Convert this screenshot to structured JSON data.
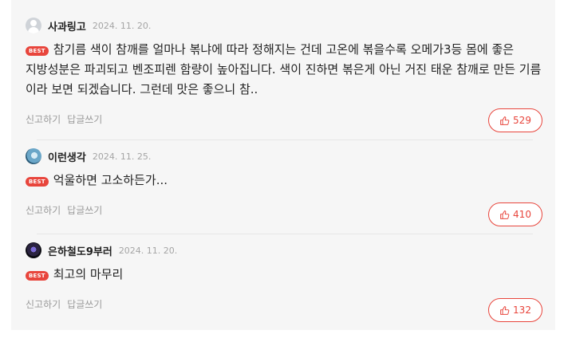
{
  "colors": {
    "accent": "#e8453c",
    "muted": "#9a9a9a",
    "panel_bg": "#f6f6f6"
  },
  "comments": [
    {
      "nickname": "사과링고",
      "date": "2024. 11. 20.",
      "avatar_icon": "default-user-icon",
      "badge": "BEST",
      "text": "참기름 색이 참깨를 얼마나 볶냐에 따라 정해지는 건데 고온에 볶을수록 오메가3등 몸에 좋은 지방성분은 파괴되고 벤조피렌 함량이 높아집니다. 색이 진하면 볶은게 아닌 거진 태운 참깨로 만든 기름 이라 보면 되겠습니다. 그런데 맛은 좋으니 참..",
      "report_label": "신고하기",
      "reply_label": "답글쓰기",
      "likes": "529"
    },
    {
      "nickname": "이런생각",
      "date": "2024. 11. 25.",
      "avatar_icon": "profile-avatar",
      "badge": "BEST",
      "text": "억울하면 고소하든가...",
      "report_label": "신고하기",
      "reply_label": "답글쓰기",
      "likes": "410"
    },
    {
      "nickname": "은하철도9부러",
      "date": "2024. 11. 20.",
      "avatar_icon": "profile-avatar",
      "badge": "BEST",
      "text": "최고의 마무리",
      "report_label": "신고하기",
      "reply_label": "답글쓰기",
      "likes": "132"
    }
  ]
}
